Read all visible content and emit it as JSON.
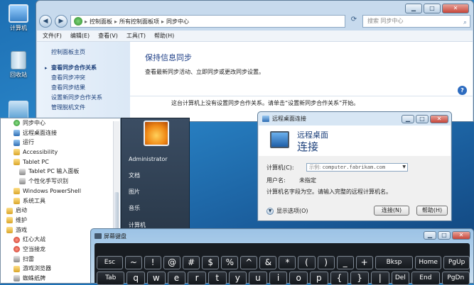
{
  "desktop": {
    "icons": [
      {
        "label": "计算机",
        "icon": "computer-icon"
      },
      {
        "label": "回收站",
        "icon": "recycle-bin-icon"
      },
      {
        "label": "",
        "icon": "tools-icon"
      }
    ]
  },
  "sync_window": {
    "breadcrumb": [
      "控制面板",
      "所有控制面板项",
      "同步中心"
    ],
    "search_placeholder": "搜索 同步中心",
    "menu": [
      "文件(F)",
      "编辑(E)",
      "查看(V)",
      "工具(T)",
      "帮助(H)"
    ],
    "controls": {
      "minimize": "▁",
      "maximize": "□",
      "close": "✕"
    },
    "sidebar_home": "控制面板主页",
    "sidebar_items": [
      "查看同步合作关系",
      "查看同步冲突",
      "查看同步结果",
      "设置新同步合作关系",
      "管理脱机文件"
    ],
    "title": "保持信息同步",
    "description": "查看最新同步活动、立即同步或更改同步设置。",
    "message": "这台计算机上没有设置同步合作关系。请单击“设置新同步合作关系”开始。"
  },
  "start_menu": {
    "programs": [
      {
        "label": "同步中心",
        "icon": "sync-icon",
        "level": 1
      },
      {
        "label": "远程桌面连接",
        "icon": "remote-desktop-icon",
        "level": 1
      },
      {
        "label": "运行",
        "icon": "run-icon",
        "level": 1
      },
      {
        "label": "Accessibility",
        "icon": "folder-icon",
        "level": 1
      },
      {
        "label": "Tablet PC",
        "icon": "folder-icon",
        "level": 1
      },
      {
        "label": "Tablet PC 输入面板",
        "icon": "tablet-input-icon",
        "level": 2
      },
      {
        "label": "个性化手写识别",
        "icon": "handwriting-icon",
        "level": 2
      },
      {
        "label": "Windows PowerShell",
        "icon": "folder-icon",
        "level": 1
      },
      {
        "label": "系统工具",
        "icon": "folder-icon",
        "level": 1
      },
      {
        "label": "启动",
        "icon": "folder-icon",
        "level": 0
      },
      {
        "label": "维护",
        "icon": "folder-icon",
        "level": 0
      },
      {
        "label": "游戏",
        "icon": "folder-icon",
        "level": 0
      },
      {
        "label": "红心大战",
        "icon": "hearts-icon",
        "level": 1
      },
      {
        "label": "空当接龙",
        "icon": "freecell-icon",
        "level": 1
      },
      {
        "label": "扫雷",
        "icon": "minesweeper-icon",
        "level": 1
      },
      {
        "label": "游戏浏览器",
        "icon": "games-explorer-icon",
        "level": 1
      },
      {
        "label": "蜘蛛纸牌",
        "icon": "spider-icon",
        "level": 1
      }
    ],
    "right_items": [
      "Administrator",
      "文档",
      "图片",
      "音乐",
      "计算机"
    ]
  },
  "rdp": {
    "title": "远程桌面连接",
    "header_line1": "远程桌面",
    "header_line2": "连接",
    "computer_label": "计算机(C):",
    "computer_hint": "示例:",
    "computer_example": "computer.fabrikam.com",
    "user_label": "用户名:",
    "user_value": "未指定",
    "info": "计算机名字段为空。请输入完整的远程计算机名。",
    "options": "显示选项(O)",
    "connect": "连接(N)",
    "help": "帮助(H)",
    "controls": {
      "minimize": "▁",
      "maximize": "□",
      "close": "✕"
    }
  },
  "osk": {
    "title": "屏幕键盘",
    "controls": {
      "minimize": "▁",
      "maximize": "□",
      "close": "✕"
    },
    "row1": [
      "Esc",
      "~",
      "!",
      "@",
      "#",
      "$",
      "%",
      "^",
      "&",
      "*",
      "(",
      ")",
      "_",
      "+",
      "Bksp",
      "Home",
      "PgUp"
    ],
    "row2": [
      "Tab",
      "q",
      "w",
      "e",
      "r",
      "t",
      "y",
      "u",
      "i",
      "o",
      "p",
      "{",
      "}",
      "|",
      "Del",
      "End",
      "PgDn"
    ]
  }
}
